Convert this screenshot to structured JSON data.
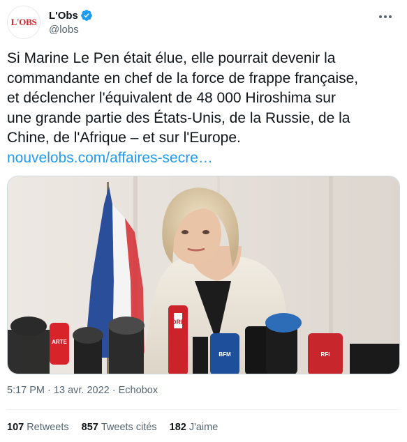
{
  "account": {
    "display_name": "L'Obs",
    "handle": "@lobs",
    "avatar_text": "L'OBS",
    "verified": true
  },
  "tweet": {
    "line1": "Si Marine Le Pen était élue, elle pourrait devenir la",
    "line2": "commandante en chef de la force de frappe française,",
    "line3": "et déclencher l'équivalent de 48 000 Hiroshima sur",
    "line4": "une grande partie des États-Unis, de la Russie, de la",
    "line5": "Chine, de l'Afrique – et sur l'Europe.",
    "link": "nouvelobs.com/affaires-secre…"
  },
  "media": {
    "mic_labels": [
      "ORF",
      "ARTE",
      "BFM",
      "RFI"
    ]
  },
  "meta": {
    "time": "5:17 PM",
    "separator": "·",
    "date": "13 avr. 2022",
    "source": "Echobox"
  },
  "stats": {
    "retweets_count": "107",
    "retweets_label": "Retweets",
    "quotes_count": "857",
    "quotes_label": "Tweets cités",
    "likes_count": "182",
    "likes_label": "J'aime"
  },
  "colors": {
    "accent": "#1d9bf0",
    "text": "#0f1419",
    "muted": "#536471",
    "brand_red": "#d8232a"
  }
}
